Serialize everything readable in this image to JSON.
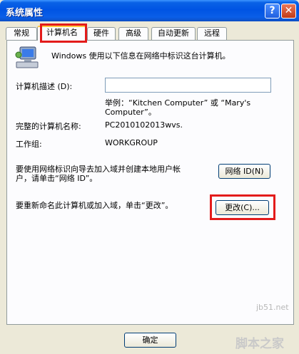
{
  "window": {
    "title": "系统属性",
    "help_glyph": "?",
    "close_glyph": "✕"
  },
  "tabs": [
    {
      "label": "常规"
    },
    {
      "label": "计算机名",
      "active": true
    },
    {
      "label": "硬件"
    },
    {
      "label": "高级"
    },
    {
      "label": "自动更新"
    },
    {
      "label": "远程"
    }
  ],
  "panel": {
    "intro": "Windows 使用以下信息在网络中标识这台计算机。",
    "description_label": "计算机描述 (D):",
    "description_value": "",
    "example_line1": "举例：“Kitchen Computer” 或 “Mary's",
    "example_line2": "Computer”。",
    "full_name_label": "完整的计算机名称:",
    "full_name_value": "PC2010102013wvs.",
    "workgroup_label": "工作组:",
    "workgroup_value": "WORKGROUP",
    "network_id_text_line1": "要使用网络标识向导去加入域并创建本地用户帐",
    "network_id_text_line2": "户，请单击“网络 ID”。",
    "network_id_button": "网络 ID(N)",
    "rename_text": "要重新命名此计算机或加入域，单击“更改”。",
    "change_button": "更改(C)..."
  },
  "footer": {
    "ok_button": "确定"
  },
  "watermark": {
    "url": "jb51.net",
    "brand": "脚本之家"
  },
  "colors": {
    "highlight": "#e31b1b",
    "title_bar": "#0054e3"
  }
}
